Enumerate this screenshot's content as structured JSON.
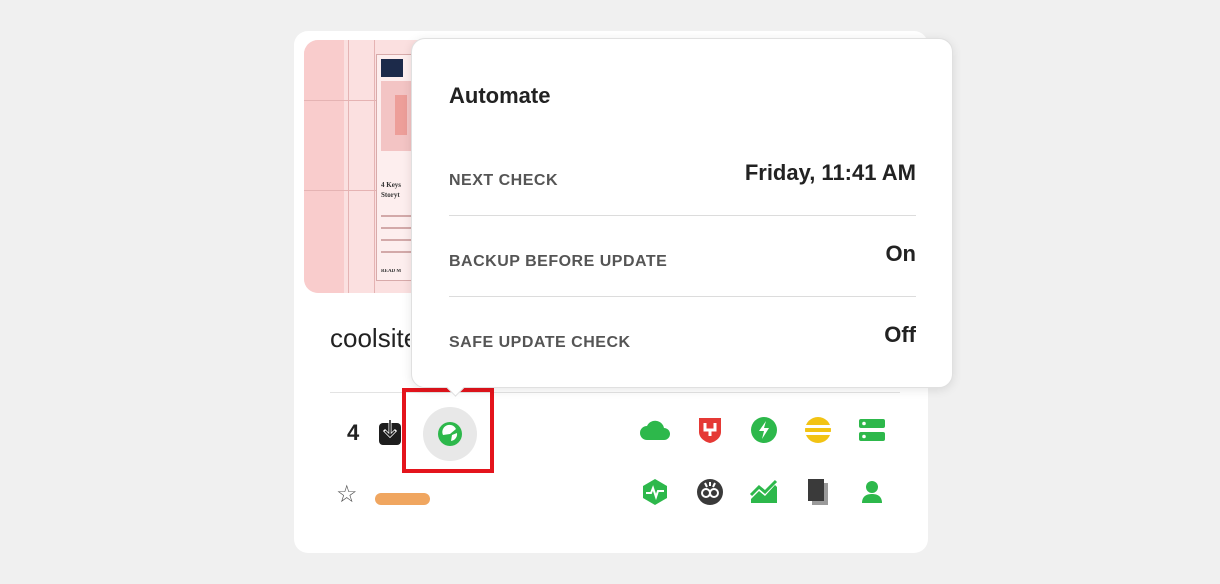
{
  "site": {
    "name": "coolsite",
    "update_count": "4",
    "thumbnail": {
      "title_line1": "4 Keys",
      "title_line2": "Storyt",
      "read_more": "READ M"
    }
  },
  "popover": {
    "title": "Automate",
    "rows": [
      {
        "label": "NEXT CHECK",
        "value": "Friday, 11:41 AM"
      },
      {
        "label": "BACKUP BEFORE UPDATE",
        "value": "On"
      },
      {
        "label": "SAFE UPDATE CHECK",
        "value": "Off"
      }
    ]
  },
  "icons": {
    "row1": [
      "cloud-icon",
      "shield-icon",
      "bolt-icon",
      "equal-circle-icon",
      "server-icon"
    ],
    "row2": [
      "uptime-monitor-icon",
      "seo-link-icon",
      "analytics-chart-icon",
      "copy-pages-icon",
      "user-icon"
    ]
  },
  "colors": {
    "accent_green": "#2db84b",
    "highlight_red": "#e4141c",
    "tag_orange": "#f0a660",
    "shield_red": "#e53935",
    "circle_yellow": "#f2c314",
    "dark_icon": "#3a3a3a"
  }
}
